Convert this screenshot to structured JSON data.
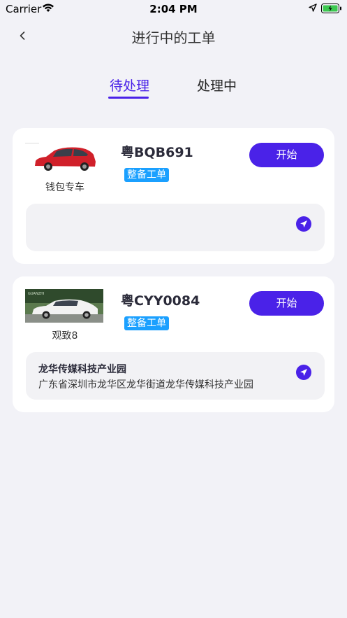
{
  "status_bar": {
    "carrier": "Carrier",
    "time": "2:04 PM"
  },
  "nav": {
    "title": "进行中的工单"
  },
  "tabs": [
    {
      "label": "待处理",
      "active": true
    },
    {
      "label": "处理中",
      "active": false
    }
  ],
  "orders": [
    {
      "car_name": "钱包专车",
      "plate": "粤BQB691",
      "badge": "整备工单",
      "start_label": "开始",
      "address_name": "",
      "address_detail": "",
      "car_color": "#d0202a"
    },
    {
      "car_name": "观致8",
      "plate": "粤CYY0084",
      "badge": "整备工单",
      "start_label": "开始",
      "address_name": "龙华传媒科技产业园",
      "address_detail": "广东省深圳市龙华区龙华街道龙华传媒科技产业园",
      "car_color": "#f2f2f2"
    }
  ],
  "colors": {
    "accent": "#4a22e8",
    "badge": "#1ba0ff",
    "background": "#f2f2f7"
  }
}
